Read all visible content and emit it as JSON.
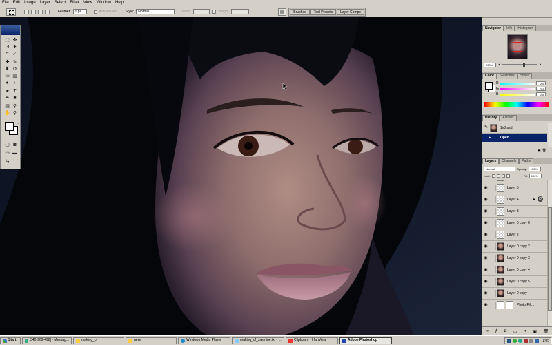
{
  "menu": [
    "File",
    "Edit",
    "Image",
    "Layer",
    "Select",
    "Filter",
    "View",
    "Window",
    "Help"
  ],
  "options": {
    "feather_label": "Feather:",
    "feather_value": "0 px",
    "anti_aliased_label": "Anti-aliased",
    "style_label": "Style:",
    "style_value": "Normal",
    "width_label": "Width:",
    "height_label": "Height:",
    "well_tabs": [
      "Brushes",
      "Tool Presets",
      "Layer Comps"
    ]
  },
  "navigator": {
    "tabs": [
      "Navigator",
      "Info",
      "Histogram"
    ],
    "zoom": "200%"
  },
  "color": {
    "tabs": [
      "Color",
      "Swatches",
      "Styles"
    ],
    "sliders": [
      {
        "label": "R",
        "value": "255"
      },
      {
        "label": "G",
        "value": "255"
      },
      {
        "label": "B",
        "value": "255"
      }
    ]
  },
  "history": {
    "tabs": [
      "History",
      "Actions"
    ],
    "items": [
      "1v3.psd",
      "Open"
    ]
  },
  "layers": {
    "tabs": [
      "Layers",
      "Channels",
      "Paths"
    ],
    "blend_mode": "Normal",
    "opacity_label": "Opacity:",
    "opacity_value": "100%",
    "lock_label": "Lock:",
    "fill_label": "Fill:",
    "fill_value": "100%",
    "items": [
      {
        "name": "Layer 5",
        "thumb": "trans"
      },
      {
        "name": "Layer 4",
        "thumb": "trans"
      },
      {
        "name": "Layer 3",
        "thumb": "trans"
      },
      {
        "name": "Layer 0 copy 6",
        "thumb": "trans"
      },
      {
        "name": "Layer 2",
        "thumb": "trans"
      },
      {
        "name": "Layer 0 copy 2",
        "thumb": "face"
      },
      {
        "name": "Layer 0 copy 3",
        "thumb": "face"
      },
      {
        "name": "Layer 0 copy 4",
        "thumb": "face"
      },
      {
        "name": "Layer 0 copy 5",
        "thumb": "face"
      },
      {
        "name": "Layer 0 copy",
        "thumb": "face"
      },
      {
        "name": "Photo Filt...",
        "thumb": "trans"
      }
    ]
  },
  "taskbar": {
    "start": "Start",
    "tasks": [
      {
        "label": "[340-969-498] - Messag..."
      },
      {
        "label": "making_of"
      },
      {
        "label": "neve"
      },
      {
        "label": "Windows Media Player"
      },
      {
        "label": "making_of_Jasmine.txt - ..."
      },
      {
        "label": "Clipboard - IrfanView"
      },
      {
        "label": "Adobe Photoshop"
      }
    ],
    "clock": "1:05"
  }
}
